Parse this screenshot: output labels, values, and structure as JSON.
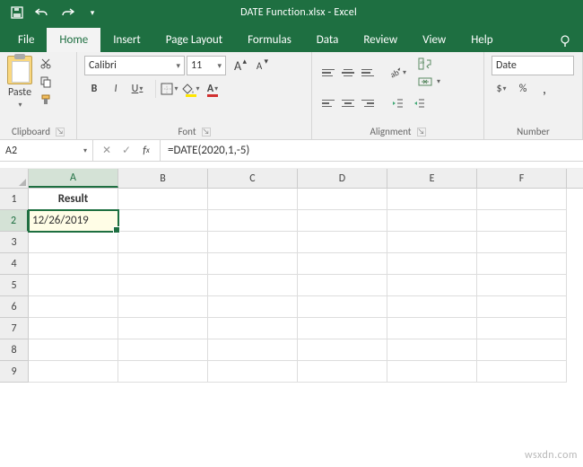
{
  "titlebar": {
    "title": "DATE Function.xlsx - Excel"
  },
  "tabs": {
    "file": "File",
    "home": "Home",
    "insert": "Insert",
    "pagelayout": "Page Layout",
    "formulas": "Formulas",
    "data": "Data",
    "review": "Review",
    "view": "View",
    "help": "Help"
  },
  "ribbon": {
    "clipboard": {
      "label": "Clipboard",
      "paste": "Paste"
    },
    "font": {
      "label": "Font",
      "name": "Calibri",
      "size": "11",
      "bold": "B",
      "italic": "I",
      "underline": "U",
      "increase": "A",
      "decrease": "A"
    },
    "alignment": {
      "label": "Alignment"
    },
    "number": {
      "label": "Number",
      "format": "Date"
    }
  },
  "namebox": "A2",
  "formula": "=DATE(2020,1,-5)",
  "columns": [
    "A",
    "B",
    "C",
    "D",
    "E",
    "F"
  ],
  "rows": [
    "1",
    "2",
    "3",
    "4",
    "5",
    "6",
    "7",
    "8",
    "9"
  ],
  "cells": {
    "A1": "Result",
    "A2": "12/26/2019"
  },
  "watermark": "wsxdn.com",
  "chart_data": null
}
